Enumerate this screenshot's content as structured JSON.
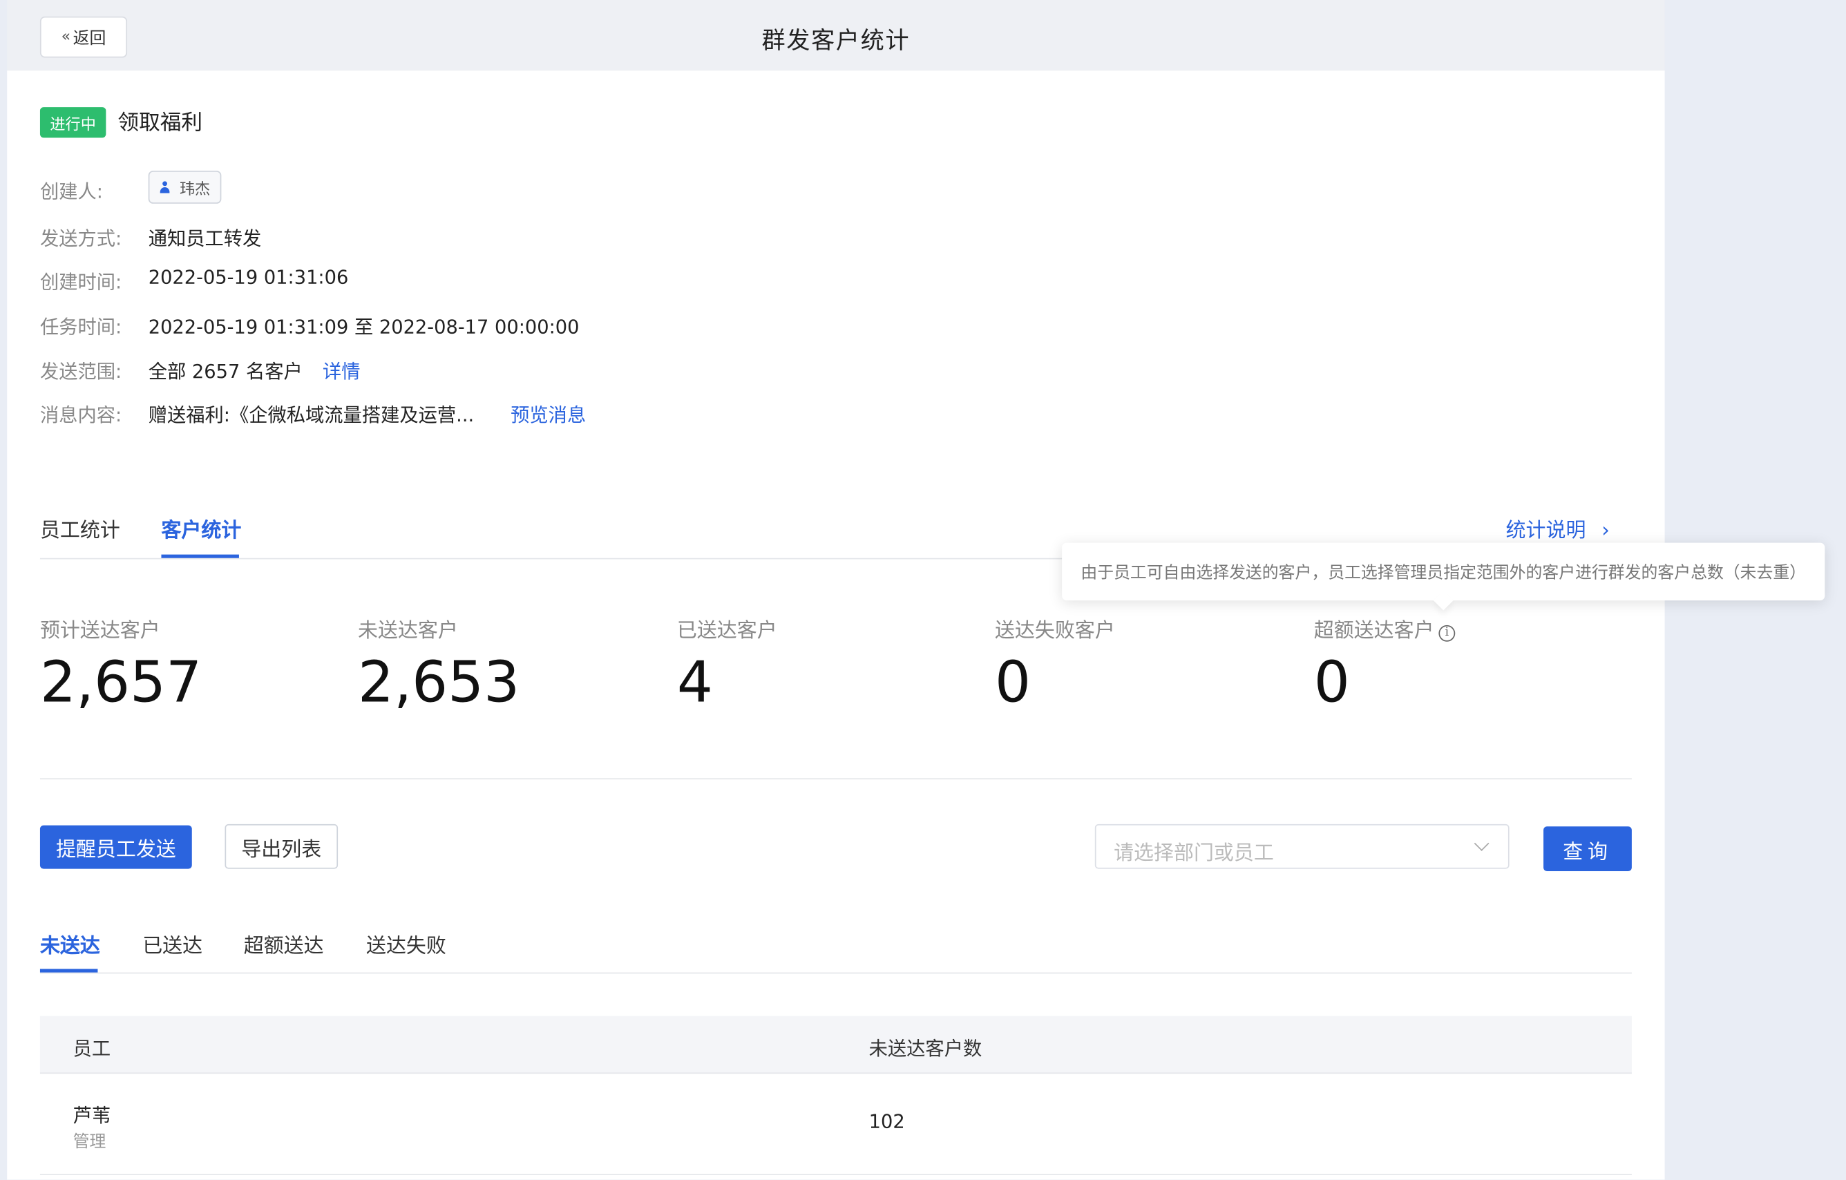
{
  "header": {
    "back_label": "返回",
    "title": "群发客户统计"
  },
  "task": {
    "status": "进行中",
    "name": "领取福利"
  },
  "info": {
    "creator_label": "创建人:",
    "creator_name": "玮杰",
    "send_method_label": "发送方式:",
    "send_method": "通知员工转发",
    "created_label": "创建时间:",
    "created_time": "2022-05-19 01:31:06",
    "task_time_label": "任务时间:",
    "task_time": "2022-05-19 01:31:09 至 2022-08-17 00:00:00",
    "scope_label": "发送范围:",
    "scope": "全部 2657 名客户",
    "scope_link": "详情",
    "content_label": "消息内容:",
    "content": "赠送福利:《企微私域流量搭建及运营...",
    "preview_link": "预览消息"
  },
  "tabs": {
    "employee": "员工统计",
    "customer": "客户统计",
    "active": "customer"
  },
  "stats_help": "统计说明",
  "stats": [
    {
      "label": "预计送达客户",
      "value": "2,657"
    },
    {
      "label": "未送达客户",
      "value": "2,653"
    },
    {
      "label": "已送达客户",
      "value": "4"
    },
    {
      "label": "送达失败客户",
      "value": "0"
    },
    {
      "label": "超额送达客户",
      "value": "0"
    }
  ],
  "tooltip": "由于员工可自由选择发送的客户，员工选择管理员指定范围外的客户进行群发的客户总数（未去重）",
  "actions": {
    "remind": "提醒员工发送",
    "export": "导出列表",
    "select_placeholder": "请选择部门或员工",
    "query": "查询"
  },
  "subtabs": [
    "未送达",
    "已送达",
    "超额送达",
    "送达失败"
  ],
  "table": {
    "headers": [
      "员工",
      "未送达客户数"
    ],
    "rows": [
      {
        "name": "芦苇",
        "dept": "管理",
        "count": "102"
      }
    ]
  },
  "colors": {
    "primary": "#2b64de",
    "success": "#2dbd6e"
  }
}
